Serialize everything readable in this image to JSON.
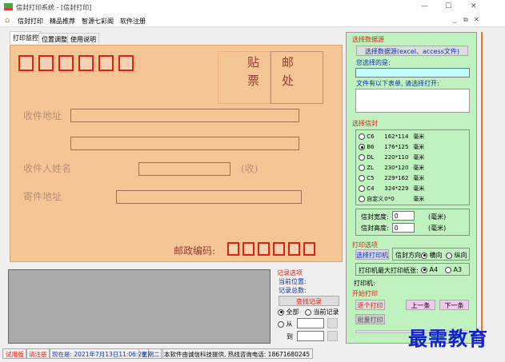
{
  "window": {
    "title": "信封打印系统 - [信封打印]"
  },
  "menu": [
    "信封打印",
    "精品推荐",
    "智源七彩阁",
    "软件注册"
  ],
  "tabs": [
    "打印监控",
    "位置调整",
    "使用说明"
  ],
  "envelope": {
    "stamp_top": "贴",
    "stamp_bottom": "票",
    "post_top": "邮",
    "post_bottom": "处",
    "recipient_address": "收件地址",
    "recipient_name": "收件人姓名",
    "name_suffix": "(收)",
    "sender_address": "寄件地址",
    "postal_code": "邮政编码:"
  },
  "records": {
    "title": "记录选项",
    "current_position": "当前位置:",
    "total": "记录总数:",
    "find_button": "查找记录",
    "opt_all": "全部",
    "opt_current": "当前记录",
    "opt_from": "从",
    "to": "到",
    "from_value": "",
    "to_value": ""
  },
  "datasource": {
    "title": "选择数据源",
    "button": "选择数据源(excel、access文件)",
    "selected_label": "您选择的是:",
    "selected_value": "",
    "tables_label": "文件有以下表单, 请选择打开:"
  },
  "envelope_select": {
    "title": "选择信封",
    "options": [
      {
        "code": "C6",
        "size": "162*114",
        "unit": "毫米",
        "checked": false
      },
      {
        "code": "B6",
        "size": "176*125",
        "unit": "毫米",
        "checked": true
      },
      {
        "code": "DL",
        "size": "220*110",
        "unit": "毫米",
        "checked": false
      },
      {
        "code": "ZL",
        "size": "230*120",
        "unit": "毫米",
        "checked": false
      },
      {
        "code": "C5",
        "size": "229*162",
        "unit": "毫米",
        "checked": false
      },
      {
        "code": "C4",
        "size": "324*229",
        "unit": "毫米",
        "checked": false
      },
      {
        "code": "自定义",
        "size": "0*0",
        "unit": "毫米",
        "checked": false
      }
    ],
    "width_label": "信封宽度:",
    "width_value": "0",
    "height_label": "信封高度:",
    "height_value": "0",
    "unit_paren": "(毫米)"
  },
  "print_options": {
    "title": "打印选项",
    "select_printer": "选择打印机",
    "orientation_label": "信封方向",
    "landscape": "横向",
    "portrait": "纵向",
    "paper_label": "打印机最大打印纸张:",
    "a4": "A4",
    "a3": "A3",
    "printer_label": "打印机:"
  },
  "start_print": {
    "title": "开始打印",
    "single": "逐个打印",
    "prev": "上一条",
    "next": "下一条",
    "batch": "批量打印"
  },
  "status": {
    "trial": "试用版",
    "register": "请注册",
    "now": "现在是: 2021年7月13日11:06:29",
    "weekday": "星期二",
    "info": "本软件由诚信科技提供, 热线咨询电话: 18671680245"
  },
  "watermark": "最需教育",
  "colors": {
    "envelope": "#f5c595",
    "panel": "#c0f2c0",
    "accent_red": "#e02010",
    "accent_blue": "#1030b0"
  }
}
